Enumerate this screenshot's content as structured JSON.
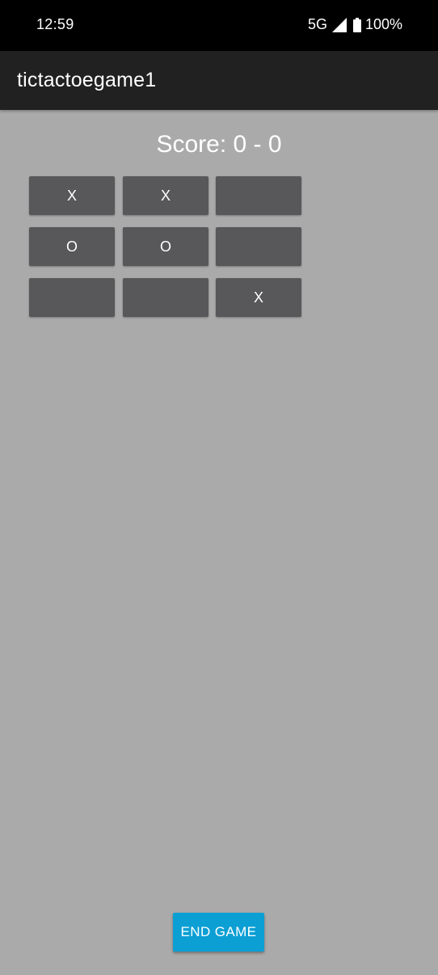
{
  "status_bar": {
    "time": "12:59",
    "network": "5G",
    "battery": "100%",
    "icons": [
      "signal-icon",
      "battery-icon"
    ]
  },
  "app_bar": {
    "title": "tictactoegame1",
    "background": "#212121"
  },
  "score": {
    "label": "Score: 0 - 0"
  },
  "board": {
    "cells": [
      [
        "X",
        "X",
        ""
      ],
      [
        "O",
        "O",
        ""
      ],
      [
        "",
        "",
        "X"
      ]
    ],
    "cell_color": "#58585a"
  },
  "end_game": {
    "label": "END GAME",
    "color": "#0b9fd4"
  }
}
